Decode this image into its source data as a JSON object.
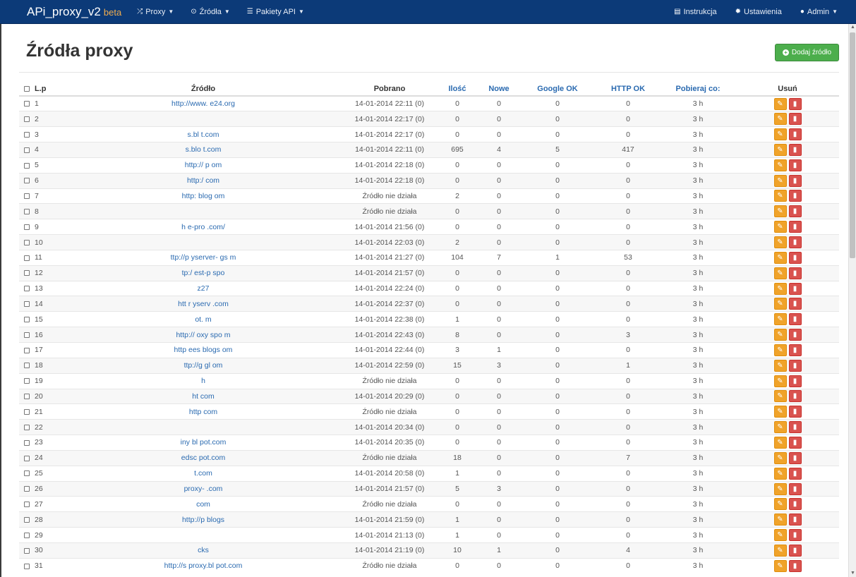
{
  "nav": {
    "brand": "APi_proxy_v2",
    "beta": "beta",
    "proxy": "Proxy",
    "zrodla": "Źródła",
    "pakiety": "Pakiety API",
    "instrukcja": "Instrukcja",
    "ustawienia": "Ustawienia",
    "admin": "Admin"
  },
  "page": {
    "title": "Źródła proxy",
    "add_button": "Dodaj źródło"
  },
  "table": {
    "headers": {
      "lp": "L.p",
      "source": "Źródło",
      "fetched": "Pobrano",
      "count": "Ilość",
      "new": "Nowe",
      "google_ok": "Google OK",
      "http_ok": "HTTP OK",
      "fetch_every": "Pobieraj co:",
      "delete": "Usuń"
    },
    "rows": [
      {
        "lp": "1",
        "source": "http://www.   e24.org",
        "fetched": "14-01-2014 22:11 (0)",
        "count": "0",
        "new": "0",
        "google": "0",
        "http": "0",
        "every": "3 h"
      },
      {
        "lp": "2",
        "source": "",
        "fetched": "14-01-2014 22:17 (0)",
        "count": "0",
        "new": "0",
        "google": "0",
        "http": "0",
        "every": "3 h"
      },
      {
        "lp": "3",
        "source": "s.bl   t.com",
        "fetched": "14-01-2014 22:17 (0)",
        "count": "0",
        "new": "0",
        "google": "0",
        "http": "0",
        "every": "3 h"
      },
      {
        "lp": "4",
        "source": "s.blo   t.com",
        "fetched": "14-01-2014 22:11 (0)",
        "count": "695",
        "new": "4",
        "google": "5",
        "http": "417",
        "every": "3 h"
      },
      {
        "lp": "5",
        "source": "http://   p   om",
        "fetched": "14-01-2014 22:18 (0)",
        "count": "0",
        "new": "0",
        "google": "0",
        "http": "0",
        "every": "3 h"
      },
      {
        "lp": "6",
        "source": "http:/   com",
        "fetched": "14-01-2014 22:18 (0)",
        "count": "0",
        "new": "0",
        "google": "0",
        "http": "0",
        "every": "3 h"
      },
      {
        "lp": "7",
        "source": "http:   blog   om",
        "fetched": "Źródło nie działa",
        "count": "2",
        "new": "0",
        "google": "0",
        "http": "0",
        "every": "3 h"
      },
      {
        "lp": "8",
        "source": "",
        "fetched": "Źródło nie działa",
        "count": "0",
        "new": "0",
        "google": "0",
        "http": "0",
        "every": "3 h"
      },
      {
        "lp": "9",
        "source": "h   e-pro   .com/",
        "fetched": "14-01-2014 21:56 (0)",
        "count": "0",
        "new": "0",
        "google": "0",
        "http": "0",
        "every": "3 h"
      },
      {
        "lp": "10",
        "source": "",
        "fetched": "14-01-2014 22:03 (0)",
        "count": "2",
        "new": "0",
        "google": "0",
        "http": "0",
        "every": "3 h"
      },
      {
        "lp": "11",
        "source": "ttp://p   yserver-   gs   m",
        "fetched": "14-01-2014 21:27 (0)",
        "count": "104",
        "new": "7",
        "google": "1",
        "http": "53",
        "every": "3 h"
      },
      {
        "lp": "12",
        "source": "tp:/   est-p   spo",
        "fetched": "14-01-2014 21:57 (0)",
        "count": "0",
        "new": "0",
        "google": "0",
        "http": "0",
        "every": "3 h"
      },
      {
        "lp": "13",
        "source": "z27",
        "fetched": "14-01-2014 22:24 (0)",
        "count": "0",
        "new": "0",
        "google": "0",
        "http": "0",
        "every": "3 h"
      },
      {
        "lp": "14",
        "source": "htt   r   yserv   .com",
        "fetched": "14-01-2014 22:37 (0)",
        "count": "0",
        "new": "0",
        "google": "0",
        "http": "0",
        "every": "3 h"
      },
      {
        "lp": "15",
        "source": "ot.   m",
        "fetched": "14-01-2014 22:38 (0)",
        "count": "1",
        "new": "0",
        "google": "0",
        "http": "0",
        "every": "3 h"
      },
      {
        "lp": "16",
        "source": "http://   oxy   spo   m",
        "fetched": "14-01-2014 22:43 (0)",
        "count": "8",
        "new": "0",
        "google": "0",
        "http": "3",
        "every": "3 h"
      },
      {
        "lp": "17",
        "source": "http   ees   blogs   om",
        "fetched": "14-01-2014 22:44 (0)",
        "count": "3",
        "new": "1",
        "google": "0",
        "http": "0",
        "every": "3 h"
      },
      {
        "lp": "18",
        "source": "ttp://g   gl   om",
        "fetched": "14-01-2014 22:59 (0)",
        "count": "15",
        "new": "3",
        "google": "0",
        "http": "1",
        "every": "3 h"
      },
      {
        "lp": "19",
        "source": "h",
        "fetched": "Źródło nie działa",
        "count": "0",
        "new": "0",
        "google": "0",
        "http": "0",
        "every": "3 h"
      },
      {
        "lp": "20",
        "source": "ht   com",
        "fetched": "14-01-2014 20:29 (0)",
        "count": "0",
        "new": "0",
        "google": "0",
        "http": "0",
        "every": "3 h"
      },
      {
        "lp": "21",
        "source": "http   com",
        "fetched": "Źródło nie działa",
        "count": "0",
        "new": "0",
        "google": "0",
        "http": "0",
        "every": "3 h"
      },
      {
        "lp": "22",
        "source": "",
        "fetched": "14-01-2014 20:34 (0)",
        "count": "0",
        "new": "0",
        "google": "0",
        "http": "0",
        "every": "3 h"
      },
      {
        "lp": "23",
        "source": "iny   bl   pot.com",
        "fetched": "14-01-2014 20:35 (0)",
        "count": "0",
        "new": "0",
        "google": "0",
        "http": "0",
        "every": "3 h"
      },
      {
        "lp": "24",
        "source": "edsc   pot.com",
        "fetched": "Źródło nie działa",
        "count": "18",
        "new": "0",
        "google": "0",
        "http": "7",
        "every": "3 h"
      },
      {
        "lp": "25",
        "source": "t.com",
        "fetched": "14-01-2014 20:58 (0)",
        "count": "1",
        "new": "0",
        "google": "0",
        "http": "0",
        "every": "3 h"
      },
      {
        "lp": "26",
        "source": "proxy-   .com",
        "fetched": "14-01-2014 21:57 (0)",
        "count": "5",
        "new": "3",
        "google": "0",
        "http": "0",
        "every": "3 h"
      },
      {
        "lp": "27",
        "source": "com",
        "fetched": "Źródło nie działa",
        "count": "0",
        "new": "0",
        "google": "0",
        "http": "0",
        "every": "3 h"
      },
      {
        "lp": "28",
        "source": "http://p   blogs",
        "fetched": "14-01-2014 21:59 (0)",
        "count": "1",
        "new": "0",
        "google": "0",
        "http": "0",
        "every": "3 h"
      },
      {
        "lp": "29",
        "source": "",
        "fetched": "14-01-2014 21:13 (0)",
        "count": "1",
        "new": "0",
        "google": "0",
        "http": "0",
        "every": "3 h"
      },
      {
        "lp": "30",
        "source": "cks",
        "fetched": "14-01-2014 21:19 (0)",
        "count": "10",
        "new": "1",
        "google": "0",
        "http": "4",
        "every": "3 h"
      },
      {
        "lp": "31",
        "source": "http://s   proxy.bl   pot.com",
        "fetched": "Źródło nie działa",
        "count": "0",
        "new": "0",
        "google": "0",
        "http": "0",
        "every": "3 h"
      }
    ]
  }
}
